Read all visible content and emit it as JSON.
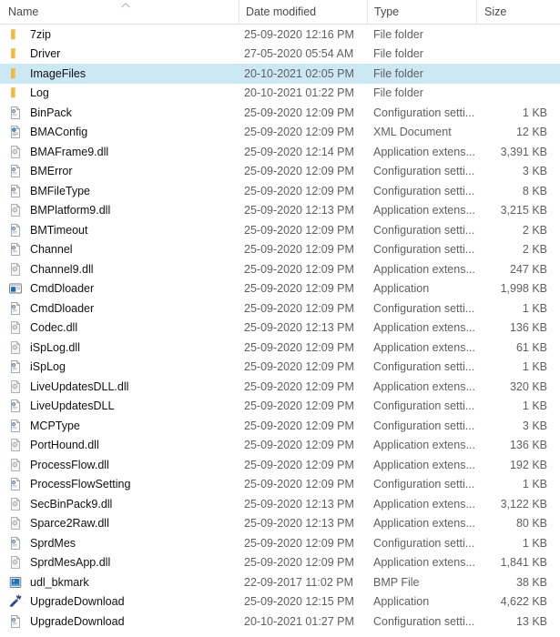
{
  "window": {
    "view": "details"
  },
  "columns": {
    "name": "Name",
    "date_modified": "Date modified",
    "type": "Type",
    "size": "Size",
    "sort_column": "Name",
    "sort_indicator": "˄"
  },
  "colors": {
    "selection": "#cce8f4",
    "folder": "#f6bd3b",
    "application": "#1d6fb8",
    "header_text": "#4a4a4a",
    "row_text": "#111111",
    "secondary_text": "#5f5f5f"
  },
  "rows": [
    {
      "name": "7zip",
      "date": "25-09-2020 12:16 PM",
      "type": "File folder",
      "size": "",
      "icon": "folder-icon",
      "selected": false
    },
    {
      "name": "Driver",
      "date": "27-05-2020 05:54 AM",
      "type": "File folder",
      "size": "",
      "icon": "folder-icon",
      "selected": false
    },
    {
      "name": "ImageFiles",
      "date": "20-10-2021 02:05 PM",
      "type": "File folder",
      "size": "",
      "icon": "folder-icon",
      "selected": true
    },
    {
      "name": "Log",
      "date": "20-10-2021 01:22 PM",
      "type": "File folder",
      "size": "",
      "icon": "folder-icon",
      "selected": false
    },
    {
      "name": "BinPack",
      "date": "25-09-2020 12:09 PM",
      "type": "Configuration setti...",
      "size": "1 KB",
      "icon": "config-file-icon",
      "selected": false
    },
    {
      "name": "BMAConfig",
      "date": "25-09-2020 12:09 PM",
      "type": "XML Document",
      "size": "12 KB",
      "icon": "xml-document-icon",
      "selected": false
    },
    {
      "name": "BMAFrame9.dll",
      "date": "25-09-2020 12:14 PM",
      "type": "Application extens...",
      "size": "3,391 KB",
      "icon": "dll-file-icon",
      "selected": false
    },
    {
      "name": "BMError",
      "date": "25-09-2020 12:09 PM",
      "type": "Configuration setti...",
      "size": "3 KB",
      "icon": "config-file-icon",
      "selected": false
    },
    {
      "name": "BMFileType",
      "date": "25-09-2020 12:09 PM",
      "type": "Configuration setti...",
      "size": "8 KB",
      "icon": "config-file-icon",
      "selected": false
    },
    {
      "name": "BMPlatform9.dll",
      "date": "25-09-2020 12:13 PM",
      "type": "Application extens...",
      "size": "3,215 KB",
      "icon": "dll-file-icon",
      "selected": false
    },
    {
      "name": "BMTimeout",
      "date": "25-09-2020 12:09 PM",
      "type": "Configuration setti...",
      "size": "2 KB",
      "icon": "config-file-icon",
      "selected": false
    },
    {
      "name": "Channel",
      "date": "25-09-2020 12:09 PM",
      "type": "Configuration setti...",
      "size": "2 KB",
      "icon": "config-file-icon",
      "selected": false
    },
    {
      "name": "Channel9.dll",
      "date": "25-09-2020 12:09 PM",
      "type": "Application extens...",
      "size": "247 KB",
      "icon": "dll-file-icon",
      "selected": false
    },
    {
      "name": "CmdDloader",
      "date": "25-09-2020 12:09 PM",
      "type": "Application",
      "size": "1,998 KB",
      "icon": "application-icon",
      "selected": false
    },
    {
      "name": "CmdDloader",
      "date": "25-09-2020 12:09 PM",
      "type": "Configuration setti...",
      "size": "1 KB",
      "icon": "config-file-icon",
      "selected": false
    },
    {
      "name": "Codec.dll",
      "date": "25-09-2020 12:13 PM",
      "type": "Application extens...",
      "size": "136 KB",
      "icon": "dll-file-icon",
      "selected": false
    },
    {
      "name": "iSpLog.dll",
      "date": "25-09-2020 12:09 PM",
      "type": "Application extens...",
      "size": "61 KB",
      "icon": "dll-file-icon",
      "selected": false
    },
    {
      "name": "iSpLog",
      "date": "25-09-2020 12:09 PM",
      "type": "Configuration setti...",
      "size": "1 KB",
      "icon": "config-file-icon",
      "selected": false
    },
    {
      "name": "LiveUpdatesDLL.dll",
      "date": "25-09-2020 12:09 PM",
      "type": "Application extens...",
      "size": "320 KB",
      "icon": "dll-file-icon",
      "selected": false
    },
    {
      "name": "LiveUpdatesDLL",
      "date": "25-09-2020 12:09 PM",
      "type": "Configuration setti...",
      "size": "1 KB",
      "icon": "config-file-icon",
      "selected": false
    },
    {
      "name": "MCPType",
      "date": "25-09-2020 12:09 PM",
      "type": "Configuration setti...",
      "size": "3 KB",
      "icon": "config-file-icon",
      "selected": false
    },
    {
      "name": "PortHound.dll",
      "date": "25-09-2020 12:09 PM",
      "type": "Application extens...",
      "size": "136 KB",
      "icon": "dll-file-icon",
      "selected": false
    },
    {
      "name": "ProcessFlow.dll",
      "date": "25-09-2020 12:09 PM",
      "type": "Application extens...",
      "size": "192 KB",
      "icon": "dll-file-icon",
      "selected": false
    },
    {
      "name": "ProcessFlowSetting",
      "date": "25-09-2020 12:09 PM",
      "type": "Configuration setti...",
      "size": "1 KB",
      "icon": "config-file-icon",
      "selected": false
    },
    {
      "name": "SecBinPack9.dll",
      "date": "25-09-2020 12:13 PM",
      "type": "Application extens...",
      "size": "3,122 KB",
      "icon": "dll-file-icon",
      "selected": false
    },
    {
      "name": "Sparce2Raw.dll",
      "date": "25-09-2020 12:13 PM",
      "type": "Application extens...",
      "size": "80 KB",
      "icon": "dll-file-icon",
      "selected": false
    },
    {
      "name": "SprdMes",
      "date": "25-09-2020 12:09 PM",
      "type": "Configuration setti...",
      "size": "1 KB",
      "icon": "config-file-icon",
      "selected": false
    },
    {
      "name": "SprdMesApp.dll",
      "date": "25-09-2020 12:09 PM",
      "type": "Application extens...",
      "size": "1,841 KB",
      "icon": "dll-file-icon",
      "selected": false
    },
    {
      "name": "udl_bkmark",
      "date": "22-09-2017 11:02 PM",
      "type": "BMP File",
      "size": "38 KB",
      "icon": "bmp-file-icon",
      "selected": false
    },
    {
      "name": "UpgradeDownload",
      "date": "25-09-2020 12:15 PM",
      "type": "Application",
      "size": "4,622 KB",
      "icon": "upgrade-app-icon",
      "selected": false
    },
    {
      "name": "UpgradeDownload",
      "date": "20-10-2021 01:27 PM",
      "type": "Configuration setti...",
      "size": "13 KB",
      "icon": "config-file-icon",
      "selected": false
    }
  ]
}
